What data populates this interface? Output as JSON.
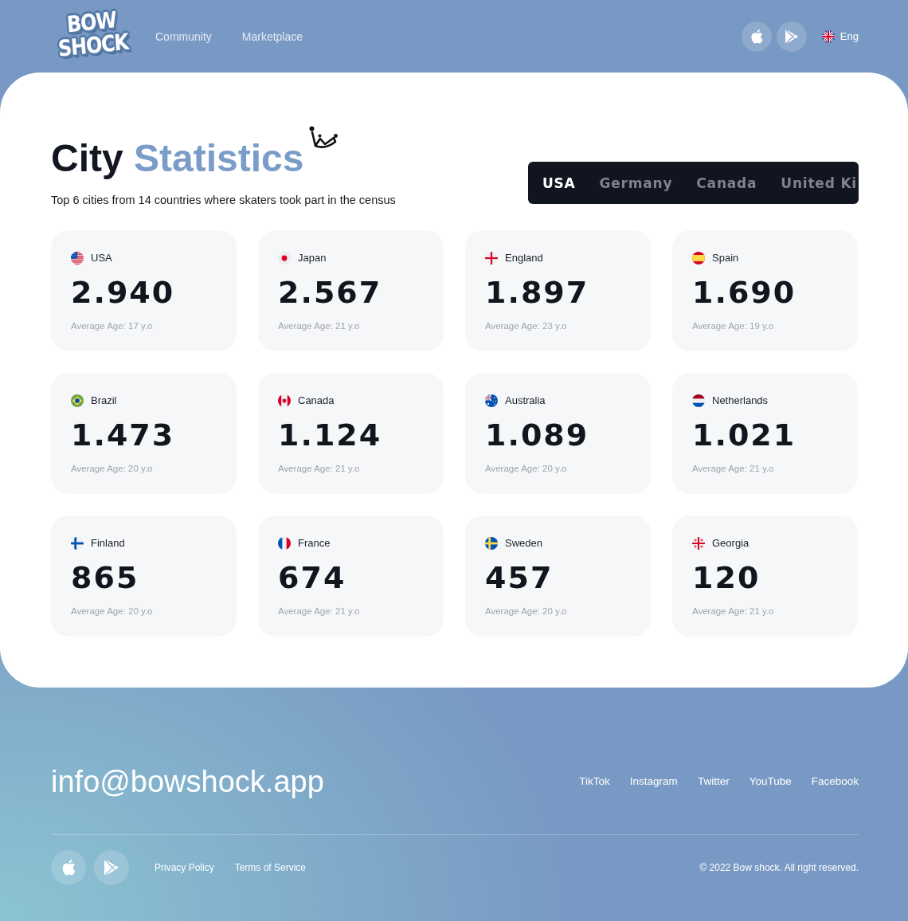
{
  "header": {
    "logo": [
      "BOW",
      "SHOCK"
    ],
    "nav": [
      "Community",
      "Marketplace"
    ],
    "language": "Eng"
  },
  "stats": {
    "title": {
      "text": "City",
      "highlight": "Statistics"
    },
    "subtitle": "Top 6 cities from 14 countries where skaters took part in the census",
    "tabs": [
      {
        "label": "USA",
        "selected": true
      },
      {
        "label": "Germany",
        "selected": false
      },
      {
        "label": "Canada",
        "selected": false
      },
      {
        "label": "United Ki",
        "selected": false
      }
    ],
    "cards": [
      {
        "country": "USA",
        "count": "2.940",
        "average_age": "Average Age: 17 y.o"
      },
      {
        "country": "Japan",
        "count": "2.567",
        "average_age": "Average Age: 21 y.o"
      },
      {
        "country": "England",
        "count": "1.897",
        "average_age": "Average Age: 23 y.o"
      },
      {
        "country": "Spain",
        "count": "1.690",
        "average_age": "Average Age: 19 y.o"
      },
      {
        "country": "Brazil",
        "count": "1.473",
        "average_age": "Average Age: 20 y.o"
      },
      {
        "country": "Canada",
        "count": "1.124",
        "average_age": "Average Age: 21 y.o"
      },
      {
        "country": "Australia",
        "count": "1.089",
        "average_age": "Average Age: 20 y.o"
      },
      {
        "country": "Netherlands",
        "count": "1.021",
        "average_age": "Average Age: 21 y.o"
      },
      {
        "country": "Finland",
        "count": "865",
        "average_age": "Average Age: 20 y.o"
      },
      {
        "country": "France",
        "count": "674",
        "average_age": "Average Age: 21 y.o"
      },
      {
        "country": "Sweden",
        "count": "457",
        "average_age": "Average Age: 20 y.o"
      },
      {
        "country": "Georgia",
        "count": "120",
        "average_age": "Average Age: 21 y.o"
      }
    ]
  },
  "footer": {
    "email": "info@bowshock.app",
    "social_links": [
      "TikTok",
      "Instagram",
      "Twitter",
      "YouTube",
      "Facebook"
    ],
    "legal_links": [
      "Privacy Policy",
      "Terms of Service"
    ],
    "copyright": "© 2022 Bow shock. All right reserved."
  }
}
